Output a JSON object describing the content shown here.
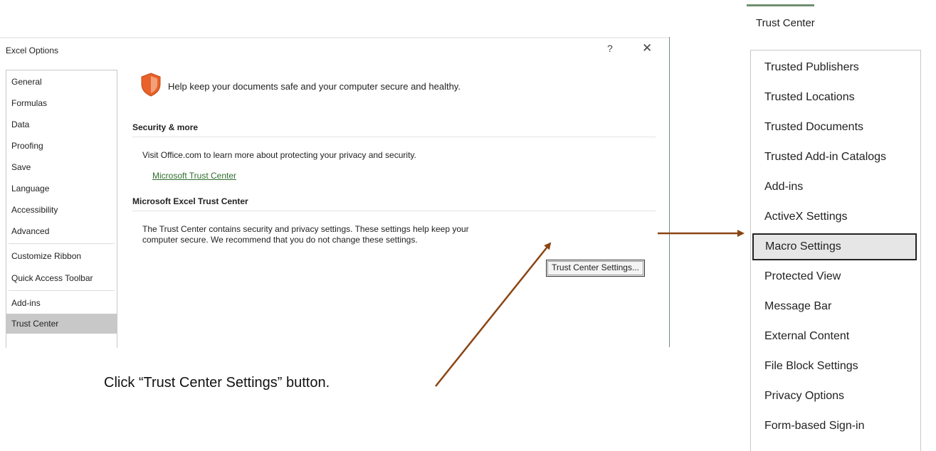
{
  "dialog": {
    "title": "Excel Options",
    "help_label": "?",
    "close_label": "✕"
  },
  "nav": {
    "items": [
      {
        "label": "General"
      },
      {
        "label": "Formulas"
      },
      {
        "label": "Data"
      },
      {
        "label": "Proofing"
      },
      {
        "label": "Save"
      },
      {
        "label": "Language"
      },
      {
        "label": "Accessibility"
      },
      {
        "label": "Advanced"
      },
      {
        "label": "Customize Ribbon"
      },
      {
        "label": "Quick Access Toolbar"
      },
      {
        "label": "Add-ins"
      },
      {
        "label": "Trust Center"
      }
    ],
    "selected": "Trust Center"
  },
  "content": {
    "tagline": "Help keep your documents safe and your computer secure and healthy.",
    "security_heading": "Security & more",
    "security_text": "Visit Office.com to learn more about protecting your privacy and security.",
    "trust_link": "Microsoft Trust Center",
    "trust_center_heading": "Microsoft Excel Trust Center",
    "trust_center_text_line1": "The Trust Center contains security and privacy settings. These settings help keep your",
    "trust_center_text_line2": "computer secure. We recommend that you do not change these settings.",
    "trust_center_button": "Trust Center Settings..."
  },
  "annotation": {
    "caption": "Click “Trust Center Settings” button.",
    "arrow_color": "#8b4513"
  },
  "trust_center_panel": {
    "title": "Trust Center",
    "items": [
      {
        "label": "Trusted Publishers"
      },
      {
        "label": "Trusted Locations"
      },
      {
        "label": "Trusted Documents"
      },
      {
        "label": "Trusted Add-in Catalogs"
      },
      {
        "label": "Add-ins"
      },
      {
        "label": "ActiveX Settings"
      },
      {
        "label": "Macro Settings"
      },
      {
        "label": "Protected View"
      },
      {
        "label": "Message Bar"
      },
      {
        "label": "External Content"
      },
      {
        "label": "File Block Settings"
      },
      {
        "label": "Privacy Options"
      },
      {
        "label": "Form-based Sign-in"
      }
    ],
    "selected": "Macro Settings"
  },
  "colors": {
    "shield": "#e8622a",
    "link": "#2f6f2f",
    "nav_selected": "#c8c8c8"
  }
}
